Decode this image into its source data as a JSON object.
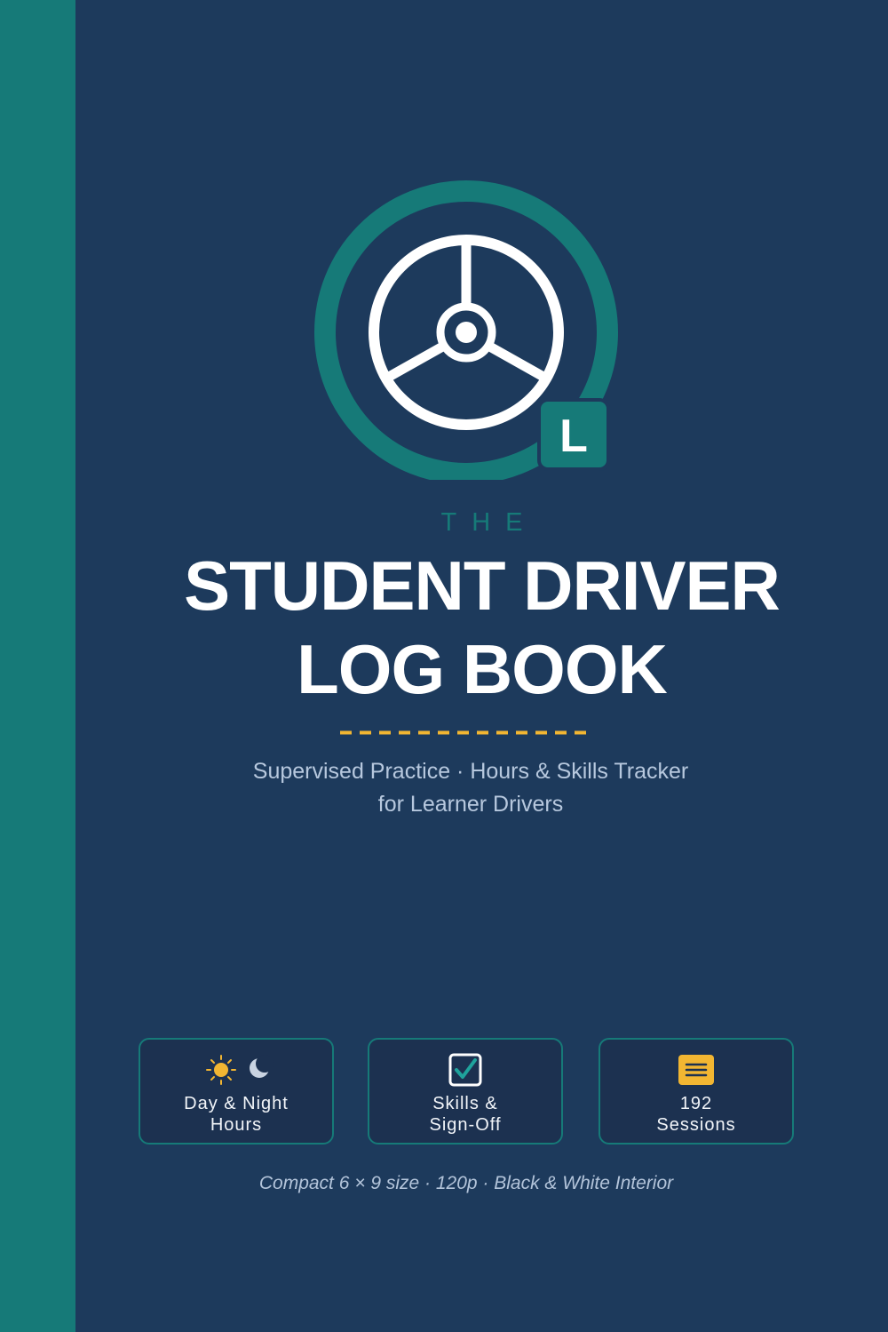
{
  "cover": {
    "pre_title": "THE",
    "title_line1": "STUDENT DRIVER",
    "title_line2": "LOG BOOK",
    "subtitle_line1": "Supervised Practice · Hours & Skills Tracker",
    "subtitle_line2": "for Learner Drivers",
    "badge_letter": "L",
    "spec_line": "Compact 6 × 9 size · 120p · Black & White Interior"
  },
  "features": [
    {
      "icon": "sun-moon-icon",
      "line1": "Day & Night",
      "line2": "Hours"
    },
    {
      "icon": "checkbox-icon",
      "line1": "Skills &",
      "line2": "Sign-Off"
    },
    {
      "icon": "notes-icon",
      "line1": "192",
      "line2": "Sessions"
    }
  ],
  "colors": {
    "background": "#1d3a5c",
    "spine": "#167a78",
    "accent_teal": "#167a78",
    "accent_yellow": "#f2b632",
    "title": "#ffffff"
  }
}
